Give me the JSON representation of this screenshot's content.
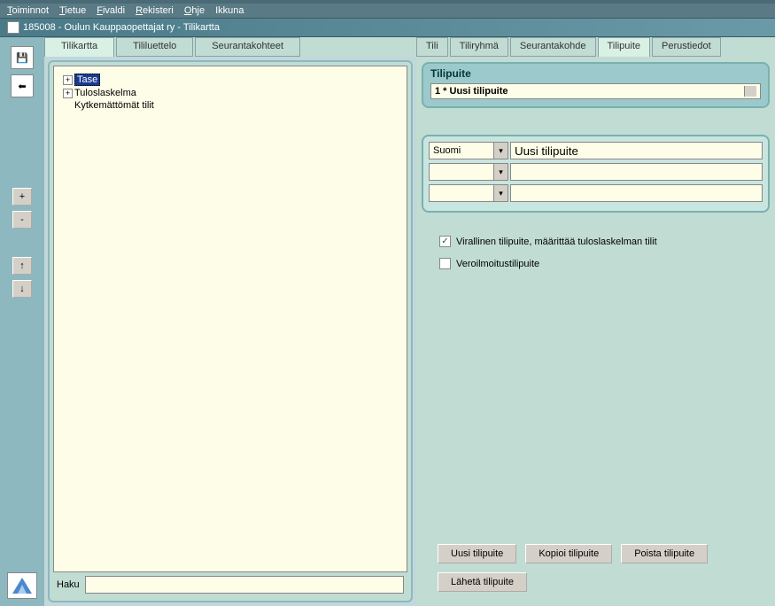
{
  "menu": {
    "toiminnot": "Toiminnot",
    "tietue": "Tietue",
    "fivaldi": "Fivaldi",
    "rekisteri": "Rekisteri",
    "ohje": "Ohje",
    "ikkuna": "Ikkuna"
  },
  "window_title": "185008 - Oulun Kauppaopettajat ry - Tilikartta",
  "left_tabs": {
    "tilikartta": "Tilikartta",
    "tililuettelo": "Tililuettelo",
    "seurantakohteet": "Seurantakohteet"
  },
  "right_tabs": {
    "tili": "Tili",
    "tiliryhma": "Tiliryhmä",
    "seurantakohde": "Seurantakohde",
    "tilipuite": "Tilipuite",
    "perustiedot": "Perustiedot"
  },
  "tree": {
    "tase": "Tase",
    "tuloslaskelma": "Tuloslaskelma",
    "kytkemattomat": "Kytkemättömät tilit"
  },
  "haku_label": "Haku",
  "panel": {
    "title": "Tilipuite",
    "name_value": "1 * Uusi tilipuite",
    "lang_value": "Suomi",
    "desc_value": "Uusi tilipuite",
    "check_virallinen": "Virallinen tilipuite, määrittää tuloslaskelman tilit",
    "check_vero": "Veroilmoitustilipuite",
    "btn_uusi": "Uusi tilipuite",
    "btn_kopioi": "Kopioi tilipuite",
    "btn_poista": "Poista tilipuite",
    "btn_laheta": "Lähetä tilipuite"
  },
  "unicode": {
    "save": "💾",
    "back": "⬅",
    "plus": "+",
    "minus": "-",
    "up": "↑",
    "down": "↓",
    "check": "✓",
    "arrow": "▾"
  }
}
